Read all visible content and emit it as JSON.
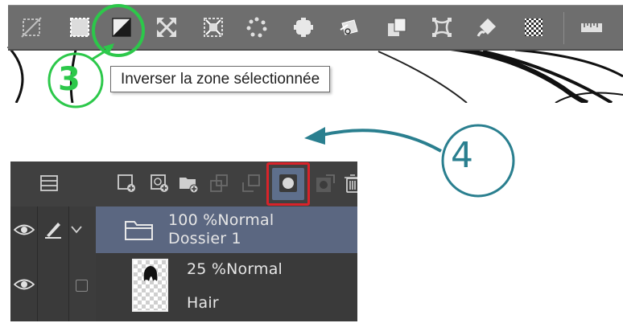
{
  "tooltip": {
    "text": "Inverser la zone sélectionnée"
  },
  "annotations": {
    "step3": "3",
    "step4": "4"
  },
  "toolbar": {
    "buttons": [
      {
        "name": "deselect-icon"
      },
      {
        "name": "convert-selection-icon"
      },
      {
        "name": "invert-selection-icon",
        "highlighted": true
      },
      {
        "name": "expand-selection-icon"
      },
      {
        "name": "shrink-selection-icon"
      },
      {
        "name": "dotted-selection-icon"
      },
      {
        "name": "selection-stamp-icon"
      },
      {
        "name": "scale-rotate-icon"
      },
      {
        "name": "copy-paste-icon"
      },
      {
        "name": "transform-icon"
      },
      {
        "name": "fill-icon"
      },
      {
        "name": "tone-icon"
      },
      {
        "name": "ruler-icon"
      }
    ]
  },
  "layer_panel": {
    "toolbar_buttons": [
      "layer-property-icon",
      "new-raster-layer-icon",
      "new-vector-layer-icon",
      "new-folder-icon",
      "transfer-down-icon",
      "merge-down-icon",
      "create-layer-mask-icon",
      "apply-mask-icon",
      "delete-layer-icon"
    ],
    "folder": {
      "opacity": "100 %",
      "blend": "Normal",
      "name": "Dossier 1"
    },
    "layer": {
      "opacity": "25 %",
      "blend": "Normal",
      "name": "Hair"
    }
  },
  "colors": {
    "annotation_green": "#2cc84a",
    "annotation_teal": "#2a7f8f",
    "highlight_red": "#d8232a",
    "selected_row": "#5b6781"
  }
}
